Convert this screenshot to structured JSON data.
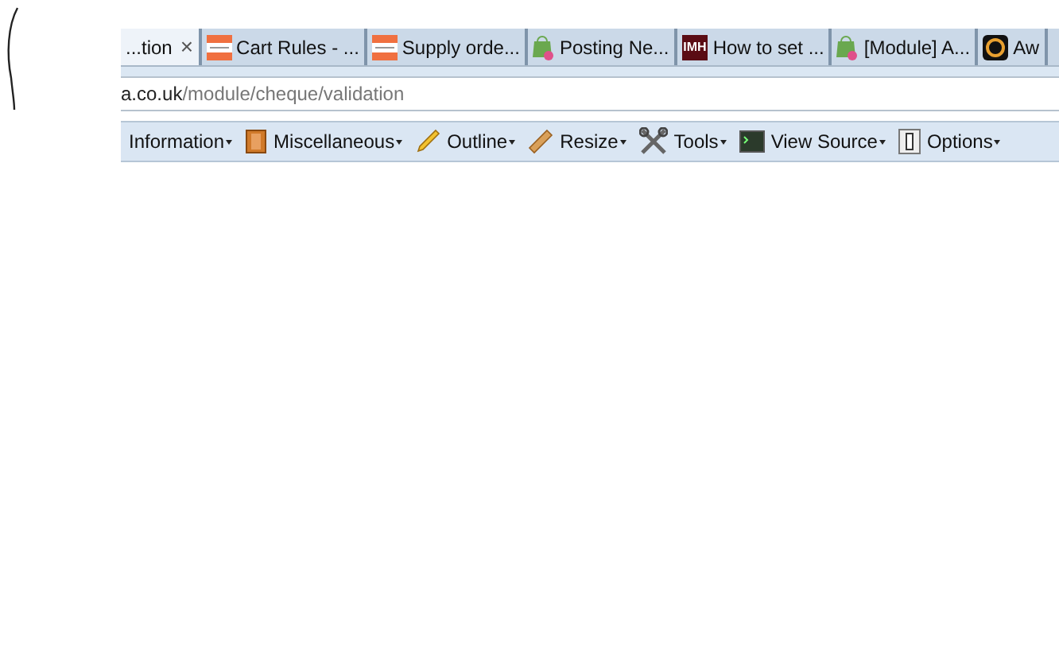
{
  "tabs": [
    {
      "label": "...tion",
      "selected": true
    },
    {
      "label": "Cart Rules - ...",
      "selected": false
    },
    {
      "label": "Supply orde...",
      "selected": false
    },
    {
      "label": "Posting Ne...",
      "selected": false
    },
    {
      "label": "How to set ...",
      "selected": false,
      "icon_text": "IMH"
    },
    {
      "label": "[Module] A...",
      "selected": false
    },
    {
      "label": "Aw",
      "selected": false
    }
  ],
  "close_glyph": "×",
  "address": {
    "host": "a.co.uk",
    "path": "/module/cheque/validation"
  },
  "toolbar": [
    {
      "label": "Information"
    },
    {
      "label": "Miscellaneous"
    },
    {
      "label": "Outline"
    },
    {
      "label": "Resize"
    },
    {
      "label": "Tools"
    },
    {
      "label": "View Source"
    },
    {
      "label": "Options"
    }
  ]
}
